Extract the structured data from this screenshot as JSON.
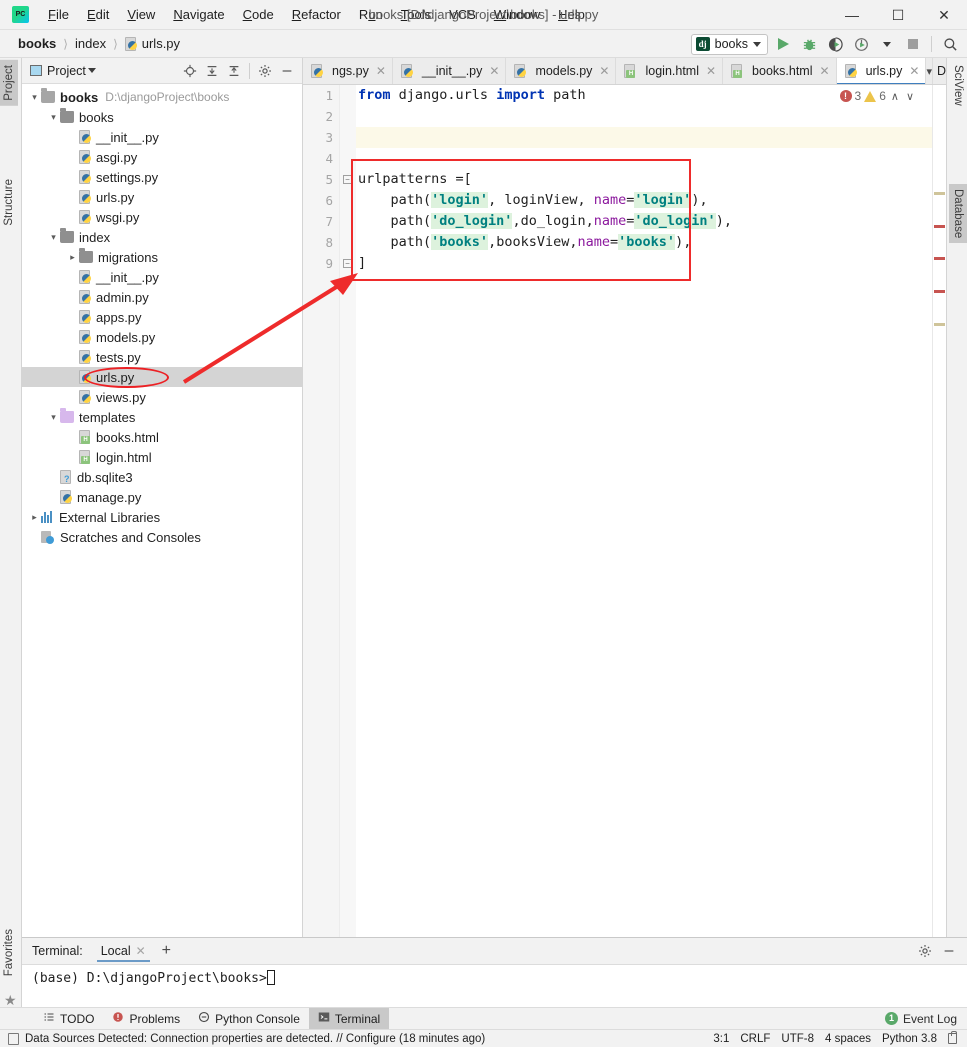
{
  "window": {
    "title": "books [D:\\djangoProject\\books] - urls.py",
    "app_icon": "pycharm-logo",
    "minimize": "—",
    "maximize": "☐",
    "close": "✕"
  },
  "menu": [
    {
      "label": "File",
      "mnemonic": "F"
    },
    {
      "label": "Edit",
      "mnemonic": "E"
    },
    {
      "label": "View",
      "mnemonic": "V"
    },
    {
      "label": "Navigate",
      "mnemonic": "N"
    },
    {
      "label": "Code",
      "mnemonic": "C"
    },
    {
      "label": "Refactor",
      "mnemonic": "R"
    },
    {
      "label": "Run",
      "mnemonic": "u"
    },
    {
      "label": "Tools",
      "mnemonic": "T"
    },
    {
      "label": "VCS",
      "mnemonic": ""
    },
    {
      "label": "Window",
      "mnemonic": "W"
    },
    {
      "label": "Help",
      "mnemonic": "H"
    }
  ],
  "breadcrumb": {
    "items": [
      "books",
      "index",
      "urls.py"
    ],
    "separator": "〉"
  },
  "toolbar": {
    "run_config_label": "books",
    "run_config_icon": "django-icon",
    "run_icon": "run-icon",
    "debug_icon": "debug-icon",
    "coverage_icon": "run-with-coverage-icon",
    "profile_icon": "profile-icon",
    "stop_icon": "stop-icon",
    "search_icon": "search-icon"
  },
  "rail_left": [
    {
      "label": "Project",
      "selected": true,
      "icon": "project-icon"
    },
    {
      "label": "Structure",
      "selected": false,
      "icon": "structure-icon"
    }
  ],
  "rail_right": [
    {
      "label": "SciView",
      "selected": false,
      "icon": "sciview-icon"
    },
    {
      "label": "Database",
      "selected": true,
      "icon": "database-icon"
    }
  ],
  "rail_left_bottom": [
    {
      "label": "Favorites",
      "icon": "star-icon"
    }
  ],
  "project_panel": {
    "title": "Project",
    "actions": [
      "locate-icon",
      "expand-all-icon",
      "collapse-all-icon",
      "gear-icon",
      "minimize-icon"
    ],
    "tree": [
      {
        "depth": 0,
        "label": "books",
        "path": "D:\\djangoProject\\books",
        "type": "folder-root",
        "arrow": "down",
        "bold": true,
        "selected": false
      },
      {
        "depth": 1,
        "label": "books",
        "path": "",
        "type": "folder-src",
        "arrow": "down",
        "bold": false,
        "selected": false
      },
      {
        "depth": 2,
        "label": "__init__.py",
        "path": "",
        "type": "python",
        "arrow": "",
        "bold": false,
        "selected": false
      },
      {
        "depth": 2,
        "label": "asgi.py",
        "path": "",
        "type": "python",
        "arrow": "",
        "bold": false,
        "selected": false
      },
      {
        "depth": 2,
        "label": "settings.py",
        "path": "",
        "type": "python",
        "arrow": "",
        "bold": false,
        "selected": false
      },
      {
        "depth": 2,
        "label": "urls.py",
        "path": "",
        "type": "python",
        "arrow": "",
        "bold": false,
        "selected": false
      },
      {
        "depth": 2,
        "label": "wsgi.py",
        "path": "",
        "type": "python",
        "arrow": "",
        "bold": false,
        "selected": false
      },
      {
        "depth": 1,
        "label": "index",
        "path": "",
        "type": "folder-src",
        "arrow": "down",
        "bold": false,
        "selected": false
      },
      {
        "depth": 2,
        "label": "migrations",
        "path": "",
        "type": "folder-src",
        "arrow": "right",
        "bold": false,
        "selected": false
      },
      {
        "depth": 2,
        "label": "__init__.py",
        "path": "",
        "type": "python",
        "arrow": "",
        "bold": false,
        "selected": false
      },
      {
        "depth": 2,
        "label": "admin.py",
        "path": "",
        "type": "python",
        "arrow": "",
        "bold": false,
        "selected": false
      },
      {
        "depth": 2,
        "label": "apps.py",
        "path": "",
        "type": "python",
        "arrow": "",
        "bold": false,
        "selected": false
      },
      {
        "depth": 2,
        "label": "models.py",
        "path": "",
        "type": "python",
        "arrow": "",
        "bold": false,
        "selected": false
      },
      {
        "depth": 2,
        "label": "tests.py",
        "path": "",
        "type": "python",
        "arrow": "",
        "bold": false,
        "selected": false
      },
      {
        "depth": 2,
        "label": "urls.py",
        "path": "",
        "type": "python",
        "arrow": "",
        "bold": false,
        "selected": true
      },
      {
        "depth": 2,
        "label": "views.py",
        "path": "",
        "type": "python",
        "arrow": "",
        "bold": false,
        "selected": false
      },
      {
        "depth": 1,
        "label": "templates",
        "path": "",
        "type": "folder-tpl",
        "arrow": "down",
        "bold": false,
        "selected": false
      },
      {
        "depth": 2,
        "label": "books.html",
        "path": "",
        "type": "html",
        "arrow": "",
        "bold": false,
        "selected": false
      },
      {
        "depth": 2,
        "label": "login.html",
        "path": "",
        "type": "html",
        "arrow": "",
        "bold": false,
        "selected": false
      },
      {
        "depth": 1,
        "label": "db.sqlite3",
        "path": "",
        "type": "sqlite",
        "arrow": "",
        "bold": false,
        "selected": false
      },
      {
        "depth": 1,
        "label": "manage.py",
        "path": "",
        "type": "python",
        "arrow": "",
        "bold": false,
        "selected": false
      },
      {
        "depth": 0,
        "label": "External Libraries",
        "path": "",
        "type": "library",
        "arrow": "right",
        "bold": false,
        "selected": false
      },
      {
        "depth": 0,
        "label": "Scratches and Consoles",
        "path": "",
        "type": "scratch",
        "arrow": "",
        "bold": false,
        "selected": false
      }
    ]
  },
  "editor": {
    "tabs": [
      {
        "label": "ngs.py",
        "type": "python",
        "active": false,
        "truncated": true
      },
      {
        "label": "__init__.py",
        "type": "python",
        "active": false,
        "truncated": false
      },
      {
        "label": "models.py",
        "type": "python",
        "active": false,
        "truncated": false
      },
      {
        "label": "login.html",
        "type": "html",
        "active": false,
        "truncated": false
      },
      {
        "label": "books.html",
        "type": "html",
        "active": false,
        "truncated": false
      },
      {
        "label": "urls.py",
        "type": "python",
        "active": true,
        "truncated": false
      }
    ],
    "tab_overflow_icon": "chevron-down-icon",
    "database_tab_label": "Data",
    "line_numbers": [
      "1",
      "2",
      "3",
      "4",
      "5",
      "6",
      "7",
      "8",
      "9"
    ],
    "current_line": 3,
    "inspection": {
      "error_count": "3",
      "warning_count": "6",
      "up_icon": "chevron-up-icon",
      "down_icon": "chevron-down-icon"
    },
    "code_lines": [
      {
        "n": 1,
        "tokens": [
          {
            "t": "from",
            "c": "kw"
          },
          {
            "t": " django.urls ",
            "c": "plain"
          },
          {
            "t": "import",
            "c": "kw"
          },
          {
            "t": " path",
            "c": "plain"
          }
        ]
      },
      {
        "n": 2,
        "tokens": []
      },
      {
        "n": 3,
        "tokens": []
      },
      {
        "n": 4,
        "tokens": []
      },
      {
        "n": 5,
        "tokens": [
          {
            "t": "urlpatterns =[",
            "c": "plain"
          }
        ]
      },
      {
        "n": 6,
        "tokens": [
          {
            "t": "    path(",
            "c": "plain"
          },
          {
            "t": "'login'",
            "c": "strp"
          },
          {
            "t": ", ",
            "c": "plain"
          },
          {
            "t": "loginView",
            "c": "plain"
          },
          {
            "t": ", ",
            "c": "plain"
          },
          {
            "t": "name",
            "c": "kwarg"
          },
          {
            "t": "=",
            "c": "plain"
          },
          {
            "t": "'login'",
            "c": "strp"
          },
          {
            "t": "),",
            "c": "plain"
          }
        ]
      },
      {
        "n": 7,
        "tokens": [
          {
            "t": "    path(",
            "c": "plain"
          },
          {
            "t": "'do_login'",
            "c": "strp"
          },
          {
            "t": ",",
            "c": "plain"
          },
          {
            "t": "do_login",
            "c": "plain"
          },
          {
            "t": ",",
            "c": "plain"
          },
          {
            "t": "name",
            "c": "kwarg"
          },
          {
            "t": "=",
            "c": "plain"
          },
          {
            "t": "'do_login'",
            "c": "strp"
          },
          {
            "t": "),",
            "c": "plain"
          }
        ]
      },
      {
        "n": 8,
        "tokens": [
          {
            "t": "    path(",
            "c": "plain"
          },
          {
            "t": "'books'",
            "c": "strp"
          },
          {
            "t": ",",
            "c": "plain"
          },
          {
            "t": "booksView",
            "c": "plain"
          },
          {
            "t": ",",
            "c": "plain"
          },
          {
            "t": "name",
            "c": "kwarg"
          },
          {
            "t": "=",
            "c": "plain"
          },
          {
            "t": "'books'",
            "c": "strp"
          },
          {
            "t": "),",
            "c": "plain"
          }
        ]
      },
      {
        "n": 9,
        "tokens": [
          {
            "t": "]",
            "c": "plain"
          }
        ]
      }
    ],
    "marker_colors": [
      "#cfc49a",
      "#c75450",
      "#c75450",
      "#c75450",
      "#cfc49a"
    ]
  },
  "terminal": {
    "label": "Terminal:",
    "tab_label": "Local",
    "close_icon": "close-icon",
    "add_icon": "add-icon",
    "gear_icon": "gear-icon",
    "minimize_icon": "minimize-icon",
    "prompt": "(base) D:\\djangoProject\\books>"
  },
  "tool_tabs": [
    {
      "label": "TODO",
      "icon": "todo-icon",
      "active": false
    },
    {
      "label": "Problems",
      "icon": "problems-icon",
      "active": false
    },
    {
      "label": "Python Console",
      "icon": "python-console-icon",
      "active": false
    },
    {
      "label": "Terminal",
      "icon": "terminal-icon",
      "active": true
    }
  ],
  "event_log": {
    "label": "Event Log",
    "icon": "event-log-icon",
    "badge": "1"
  },
  "statusbar": {
    "message": "Data Sources Detected: Connection properties are detected. // Configure (18 minutes ago)",
    "message_icon": "notification-icon",
    "caret_position": "3:1",
    "line_separator": "CRLF",
    "encoding": "UTF-8",
    "indent": "4 spaces",
    "interpreter": "Python 3.8",
    "lock_icon": "lock-icon"
  },
  "annotations": {
    "ellipse_target": "urls.py",
    "arrow_color": "#ee2b2b",
    "box_color": "#ee2b2b"
  },
  "colors": {
    "accent": "#3f7fbf",
    "error": "#c75450",
    "warning": "#ecc44b",
    "run_green": "#59a869",
    "annotation_red": "#ee2b2b",
    "keyword_blue": "#0033b3",
    "string_teal": "#008080",
    "kwarg_purple": "#8c1a9e"
  }
}
